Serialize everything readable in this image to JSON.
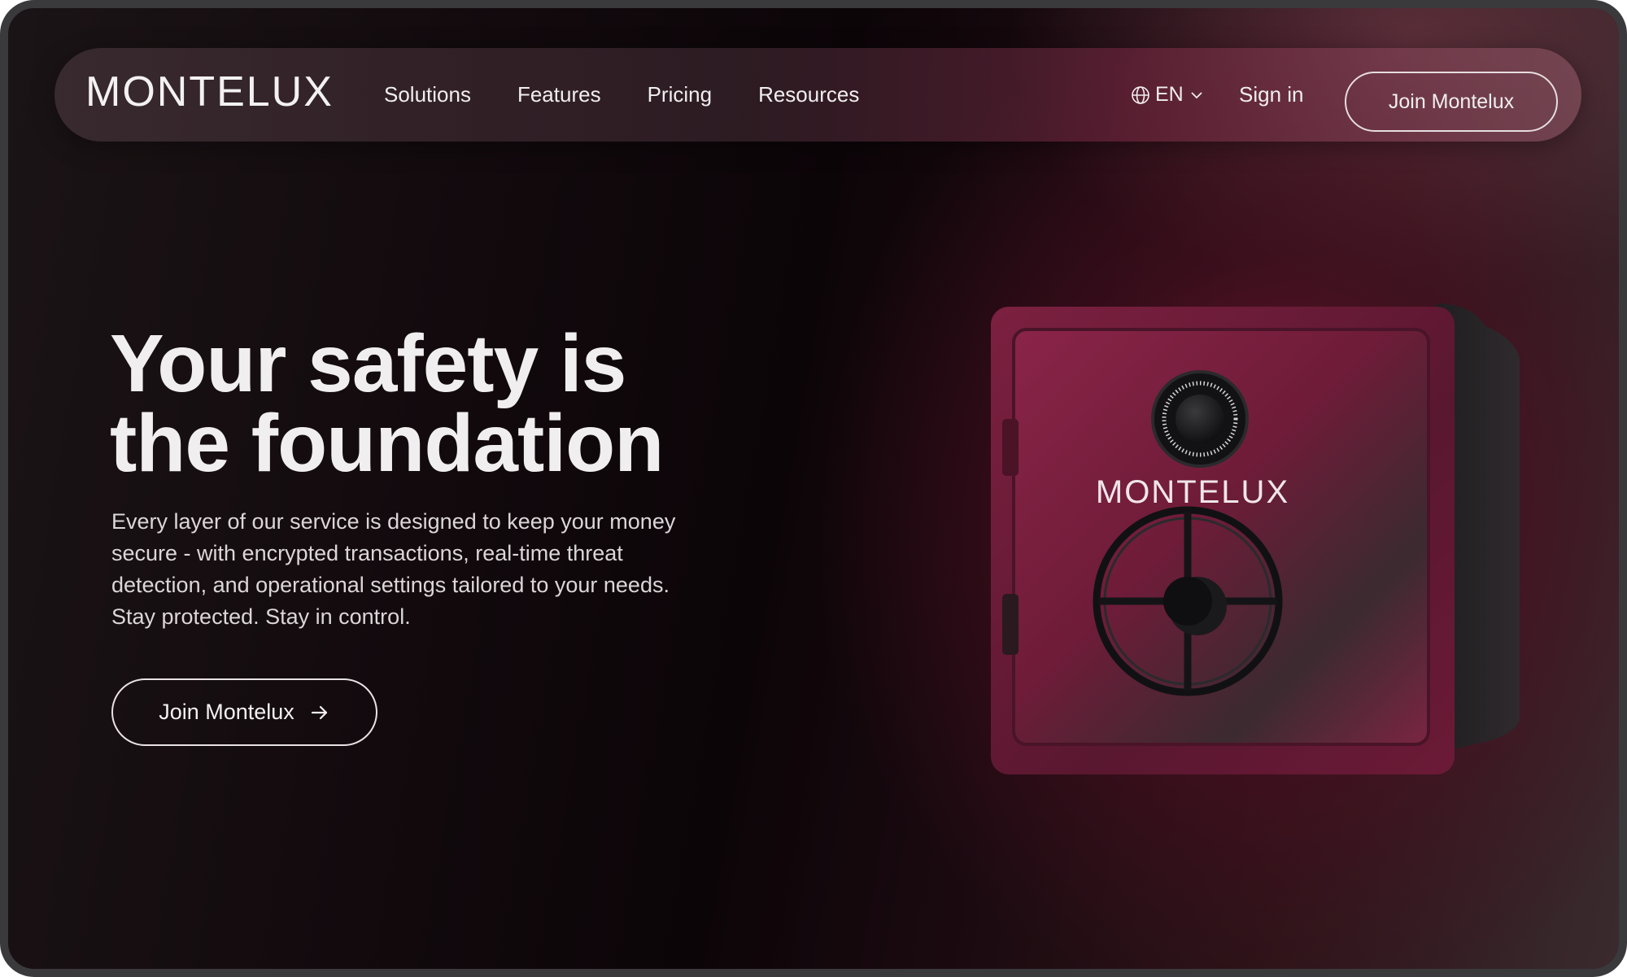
{
  "brand": {
    "name": "MONTELUX"
  },
  "nav": {
    "links": [
      {
        "label": "Solutions"
      },
      {
        "label": "Features"
      },
      {
        "label": "Pricing"
      },
      {
        "label": "Resources"
      }
    ],
    "language": "EN",
    "language_icon": "globe-icon",
    "language_chevron": "chevron-down-icon",
    "sign_in": "Sign in",
    "join_button": "Join Montelux"
  },
  "hero": {
    "headline_lines": [
      "Your safety is",
      "the foundation"
    ],
    "body_lines": [
      "Every layer of our service is designed to keep your money",
      "secure - with encrypted transactions, real-time threat",
      "detection, and operational settings tailored to your needs.",
      "Stay protected. Stay in control."
    ],
    "cta_label": "Join Montelux",
    "cta_icon": "arrow-right-icon"
  },
  "safe_image": {
    "logo_text": "MONTELUX"
  },
  "colors": {
    "accent": "#7a1d3a",
    "text": "#f0eeef"
  }
}
